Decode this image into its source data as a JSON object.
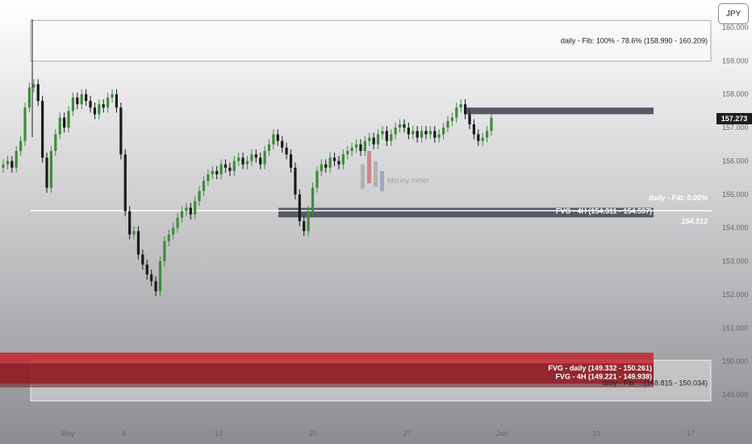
{
  "currency_button": "JPY",
  "last_price_label": "157.273",
  "watermark": "Money miner",
  "annotations": {
    "fib_daily_top": "daily - Fib: 100% - 78.6% (158.990 - 160.209)",
    "fib_daily_zero": "daily - Fib: 0.00%",
    "fvg_4h_mid": "FVG - 4H (154.311 - 154.597)",
    "level_154_512": "154.512",
    "fvg_daily_low": "FVG - daily (149.332 - 150.261)",
    "fvg_4h_low": "FVG - 4H (149.221 - 149.938)",
    "fib_daily_low_partial": "daily - Fib: ...(148.815 - 150.034)"
  },
  "colors": {
    "up": "#3f8b3a",
    "down": "#1a1a1a",
    "red_zone": "#c1272d",
    "grey_zone": "#555a66"
  },
  "chart_data": {
    "type": "candlestick",
    "symbol_currency": "JPY",
    "y_ticks": [
      "160.000",
      "159.000",
      "158.000",
      "157.000",
      "156.000",
      "155.000",
      "154.000",
      "153.000",
      "152.000",
      "151.000",
      "150.000",
      "149.000"
    ],
    "x_ticks": [
      "May",
      "6",
      "13",
      "20",
      "27",
      "Jun",
      "10",
      "17"
    ],
    "ylim": [
      148.2,
      160.3
    ],
    "last_price": 157.273,
    "zones": [
      {
        "label": "daily - Fib: 100% - 78.6%",
        "low": 158.99,
        "high": 160.209
      },
      {
        "label": "FVG - 4H",
        "low": 154.311,
        "high": 154.597
      },
      {
        "label": "FVG - daily",
        "low": 149.332,
        "high": 150.261
      },
      {
        "label": "FVG - 4H",
        "low": 149.221,
        "high": 149.938
      },
      {
        "label": "daily - Fib",
        "low": 148.815,
        "high": 150.034
      },
      {
        "label": "resistance",
        "low": 157.45,
        "high": 157.6
      }
    ],
    "levels": [
      154.512
    ],
    "close_path": [
      155.9,
      156.0,
      155.8,
      156.3,
      156.6,
      157.6,
      158.2,
      158.3,
      157.8,
      156.1,
      155.2,
      156.3,
      156.8,
      157.3,
      157.0,
      157.5,
      157.9,
      157.7,
      158.0,
      157.8,
      157.6,
      157.4,
      157.7,
      157.6,
      157.9,
      158.0,
      157.6,
      156.2,
      154.5,
      153.8,
      153.9,
      153.2,
      152.9,
      152.6,
      152.4,
      152.1,
      153.0,
      153.6,
      153.8,
      154.0,
      154.3,
      154.5,
      154.6,
      154.4,
      154.8,
      155.1,
      155.4,
      155.6,
      155.7,
      155.6,
      155.9,
      155.8,
      155.7,
      156.0,
      156.1,
      155.9,
      156.0,
      156.2,
      156.1,
      155.9,
      156.3,
      156.5,
      156.8,
      156.6,
      156.4,
      156.2,
      155.8,
      155.0,
      154.2,
      153.9,
      154.5,
      155.2,
      155.7,
      155.9,
      155.8,
      156.1,
      156.0,
      155.9,
      156.2,
      156.3,
      156.4,
      156.5,
      156.3,
      156.6,
      156.7,
      156.5,
      156.8,
      156.9,
      156.6,
      156.8,
      157.0,
      157.1,
      157.0,
      156.8,
      156.9,
      156.7,
      156.9,
      156.8,
      156.9,
      156.7,
      156.8,
      157.0,
      157.2,
      157.3,
      157.6,
      157.7,
      157.4,
      157.1,
      156.8,
      156.6,
      156.7,
      156.9,
      157.3
    ]
  }
}
